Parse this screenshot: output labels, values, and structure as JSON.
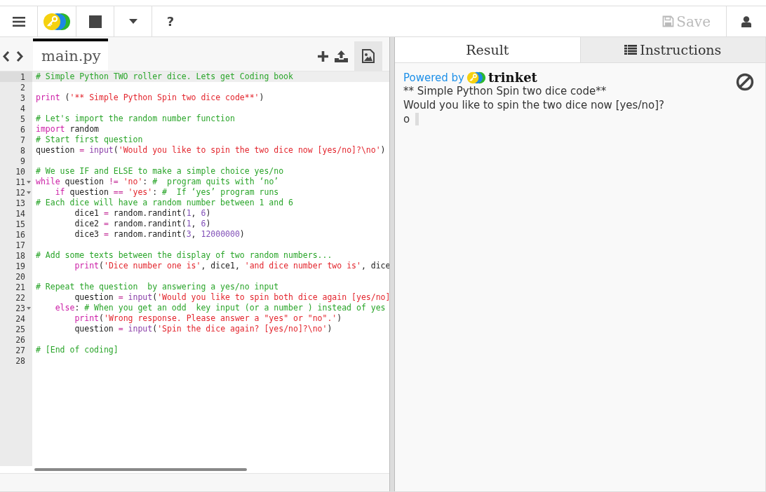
{
  "toolbar": {
    "help": "?",
    "save": {
      "label": "Save",
      "disabled": true
    }
  },
  "editor": {
    "file_tab": {
      "label": "main.py",
      "selected": true
    },
    "lines": [
      {
        "number": "1",
        "active": true,
        "foldable": false,
        "tokens": [
          {
            "kind": "comment",
            "text": "# Simple Python TWO roller dice. Lets get Coding book"
          }
        ]
      },
      {
        "number": "2",
        "active": false,
        "foldable": false
      },
      {
        "number": "3",
        "active": false,
        "foldable": false,
        "tokens": [
          {
            "kind": "keyword",
            "text": "print"
          },
          {
            "kind": "plain",
            "text": " ("
          },
          {
            "kind": "string",
            "text": "'** Simple Python Spin two dice code**'"
          },
          {
            "kind": "plain",
            "text": ")"
          }
        ]
      },
      {
        "number": "4",
        "active": false,
        "foldable": false
      },
      {
        "number": "5",
        "active": false,
        "foldable": false,
        "tokens": [
          {
            "kind": "comment",
            "text": "# Let's import the random number function"
          }
        ]
      },
      {
        "number": "6",
        "active": false,
        "foldable": false,
        "tokens": [
          {
            "kind": "keyword",
            "text": "import"
          },
          {
            "kind": "plain",
            "text": " random"
          }
        ]
      },
      {
        "number": "7",
        "active": false,
        "foldable": false,
        "tokens": [
          {
            "kind": "comment",
            "text": "# Start first question"
          }
        ]
      },
      {
        "number": "8",
        "active": false,
        "foldable": false,
        "tokens": [
          {
            "kind": "plain",
            "text": "question "
          },
          {
            "kind": "operator",
            "text": "= "
          },
          {
            "kind": "builtin",
            "text": "input"
          },
          {
            "kind": "plain",
            "text": "("
          },
          {
            "kind": "string",
            "text": "'Would you like to spin the two dice now [yes/no]?\\no'"
          },
          {
            "kind": "plain",
            "text": ")"
          }
        ]
      },
      {
        "number": "9",
        "active": false,
        "foldable": false
      },
      {
        "number": "10",
        "active": false,
        "foldable": false,
        "tokens": [
          {
            "kind": "comment",
            "text": "# We use IF and ELSE to make a simple choice yes/no"
          }
        ]
      },
      {
        "number": "11",
        "active": false,
        "foldable": true,
        "tokens": [
          {
            "kind": "keyword",
            "text": "while"
          },
          {
            "kind": "plain",
            "text": " question "
          },
          {
            "kind": "operator",
            "text": "!= "
          },
          {
            "kind": "string",
            "text": "'no'"
          },
          {
            "kind": "plain",
            "text": ": "
          },
          {
            "kind": "comment",
            "text": "#  program quits with ‘no’"
          }
        ]
      },
      {
        "number": "12",
        "active": false,
        "foldable": true,
        "tokens": [
          {
            "kind": "keyword",
            "text": "    if"
          },
          {
            "kind": "plain",
            "text": " question "
          },
          {
            "kind": "operator",
            "text": "== "
          },
          {
            "kind": "string",
            "text": "'yes'"
          },
          {
            "kind": "plain",
            "text": ": "
          },
          {
            "kind": "comment",
            "text": "#  If ‘yes’ program runs"
          }
        ]
      },
      {
        "number": "13",
        "active": false,
        "foldable": false,
        "tokens": [
          {
            "kind": "comment",
            "text": "# Each dice will have a random number between 1 and 6"
          }
        ]
      },
      {
        "number": "14",
        "active": false,
        "foldable": false,
        "tokens": [
          {
            "kind": "plain",
            "text": "        dice1 "
          },
          {
            "kind": "operator",
            "text": "="
          },
          {
            "kind": "plain",
            "text": " random.randint("
          },
          {
            "kind": "number",
            "text": "1"
          },
          {
            "kind": "plain",
            "text": ", "
          },
          {
            "kind": "number",
            "text": "6"
          },
          {
            "kind": "plain",
            "text": ")"
          }
        ]
      },
      {
        "number": "15",
        "active": false,
        "foldable": false,
        "tokens": [
          {
            "kind": "plain",
            "text": "        dice2 "
          },
          {
            "kind": "operator",
            "text": "="
          },
          {
            "kind": "plain",
            "text": " random.randint("
          },
          {
            "kind": "number",
            "text": "1"
          },
          {
            "kind": "plain",
            "text": ", "
          },
          {
            "kind": "number",
            "text": "6"
          },
          {
            "kind": "plain",
            "text": ")"
          }
        ]
      },
      {
        "number": "16",
        "active": false,
        "foldable": false,
        "tokens": [
          {
            "kind": "plain",
            "text": "        dice3 "
          },
          {
            "kind": "operator",
            "text": "="
          },
          {
            "kind": "plain",
            "text": " random.randint("
          },
          {
            "kind": "number",
            "text": "3"
          },
          {
            "kind": "plain",
            "text": ", "
          },
          {
            "kind": "number",
            "text": "12000000"
          },
          {
            "kind": "plain",
            "text": ")"
          }
        ]
      },
      {
        "number": "17",
        "active": false,
        "foldable": false
      },
      {
        "number": "18",
        "active": false,
        "foldable": false,
        "tokens": [
          {
            "kind": "comment",
            "text": "# Add some texts between the display of two random numbers..."
          }
        ]
      },
      {
        "number": "19",
        "active": false,
        "foldable": false,
        "tokens": [
          {
            "kind": "keyword",
            "text": "        print"
          },
          {
            "kind": "plain",
            "text": "("
          },
          {
            "kind": "string",
            "text": "'Dice number one is'"
          },
          {
            "kind": "plain",
            "text": ", dice1, "
          },
          {
            "kind": "string",
            "text": "'and dice number two is'"
          },
          {
            "kind": "plain",
            "text": ", dice"
          }
        ]
      },
      {
        "number": "20",
        "active": false,
        "foldable": false
      },
      {
        "number": "21",
        "active": false,
        "foldable": false,
        "tokens": [
          {
            "kind": "comment",
            "text": "# Repeat the question  by answering a yes/no input"
          }
        ]
      },
      {
        "number": "22",
        "active": false,
        "foldable": false,
        "tokens": [
          {
            "kind": "plain",
            "text": "        question "
          },
          {
            "kind": "operator",
            "text": "= "
          },
          {
            "kind": "builtin",
            "text": "input"
          },
          {
            "kind": "plain",
            "text": "("
          },
          {
            "kind": "string",
            "text": "'Would you like to spin both dice again [yes/no]"
          }
        ]
      },
      {
        "number": "23",
        "active": false,
        "foldable": true,
        "tokens": [
          {
            "kind": "keyword",
            "text": "    else"
          },
          {
            "kind": "plain",
            "text": ": "
          },
          {
            "kind": "comment",
            "text": "# When you get an odd  key input (or a number ) instead of yes"
          }
        ]
      },
      {
        "number": "24",
        "active": false,
        "foldable": false,
        "tokens": [
          {
            "kind": "keyword",
            "text": "        print"
          },
          {
            "kind": "plain",
            "text": "("
          },
          {
            "kind": "string",
            "text": "'Wrong response. Please answer a \"yes\" or \"no\".'"
          },
          {
            "kind": "plain",
            "text": ")"
          }
        ]
      },
      {
        "number": "25",
        "active": false,
        "foldable": false,
        "tokens": [
          {
            "kind": "plain",
            "text": "        question "
          },
          {
            "kind": "operator",
            "text": "= "
          },
          {
            "kind": "builtin",
            "text": "input"
          },
          {
            "kind": "plain",
            "text": "("
          },
          {
            "kind": "string",
            "text": "'Spin the dice again? [yes/no]?\\no'"
          },
          {
            "kind": "plain",
            "text": ")"
          }
        ]
      },
      {
        "number": "26",
        "active": false,
        "foldable": false
      },
      {
        "number": "27",
        "active": false,
        "foldable": false,
        "tokens": [
          {
            "kind": "comment",
            "text": "# [End of coding]"
          }
        ]
      },
      {
        "number": "28",
        "active": false,
        "foldable": false
      }
    ]
  },
  "result": {
    "tabs": [
      {
        "label": "Result",
        "selected": true
      },
      {
        "label": "Instructions",
        "selected": false
      }
    ],
    "powered_by": "Powered by",
    "brand": "trinket",
    "output": [
      "** Simple Python Spin two dice code**",
      "Would you like to spin the two dice now [yes/no]?",
      "o"
    ]
  }
}
